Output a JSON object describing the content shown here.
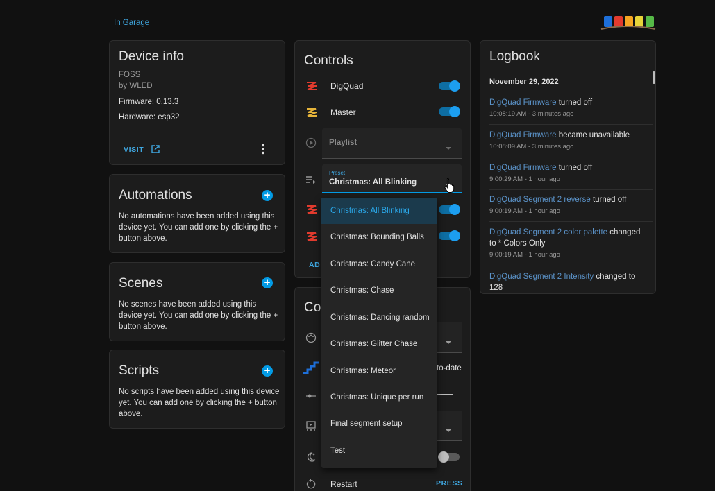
{
  "breadcrumb": "In Garage",
  "device_info": {
    "title": "Device info",
    "model": "FOSS",
    "manufacturer": "by WLED",
    "firmware": "Firmware: 0.13.3",
    "hardware": "Hardware: esp32",
    "visit_label": "VISIT"
  },
  "automations": {
    "title": "Automations",
    "text": "No automations have been added using this device yet. You can add one by clicking the + button above."
  },
  "scenes": {
    "title": "Scenes",
    "text": "No scenes have been added using this device yet. You can add one by clicking the + button above."
  },
  "scripts": {
    "title": "Scripts",
    "text": "No scripts have been added using this device yet. You can add one by clicking the + button above."
  },
  "controls": {
    "title": "Controls",
    "rows": [
      {
        "label": "DigQuad",
        "on": true
      },
      {
        "label": "Master",
        "on": true
      }
    ],
    "playlist_placeholder": "Playlist",
    "preset_label": "Preset",
    "preset_value": "Christmas: All Blinking",
    "add_label": "ADD"
  },
  "config": {
    "title_partial": "Co",
    "update_text": "to-date",
    "restart_label": "Restart",
    "press_label": "PRESS"
  },
  "preset_menu": {
    "options": [
      "Christmas: All Blinking",
      "Christmas: Bounding Balls",
      "Christmas: Candy Cane",
      "Christmas: Chase",
      "Christmas: Dancing random",
      "Christmas: Glitter Chase",
      "Christmas: Meteor",
      "Christmas: Unique per run",
      "Final segment setup",
      "Test"
    ],
    "selected": "Christmas: All Blinking"
  },
  "logbook": {
    "title": "Logbook",
    "date": "November 29, 2022",
    "entries": [
      {
        "entity": "DigQuad Firmware",
        "action": " turned off",
        "when": "10:08:19 AM - 3 minutes ago"
      },
      {
        "entity": "DigQuad Firmware",
        "action": " became unavailable",
        "when": "10:08:09 AM - 3 minutes ago"
      },
      {
        "entity": "DigQuad Firmware",
        "action": " turned off",
        "when": "9:00:29 AM - 1 hour ago"
      },
      {
        "entity": "DigQuad Segment 2 reverse",
        "action": " turned off",
        "when": "9:00:19 AM - 1 hour ago"
      },
      {
        "entity": "DigQuad Segment 2 color palette",
        "action": " changed to * Colors Only",
        "when": "9:00:19 AM - 1 hour ago"
      },
      {
        "entity": "DigQuad Segment 2 Intensity",
        "action": " changed to 128",
        "when": ""
      }
    ]
  },
  "colors": {
    "accent": "#039be5",
    "link": "#5b93c9",
    "wled_red": "#e23b2e"
  }
}
